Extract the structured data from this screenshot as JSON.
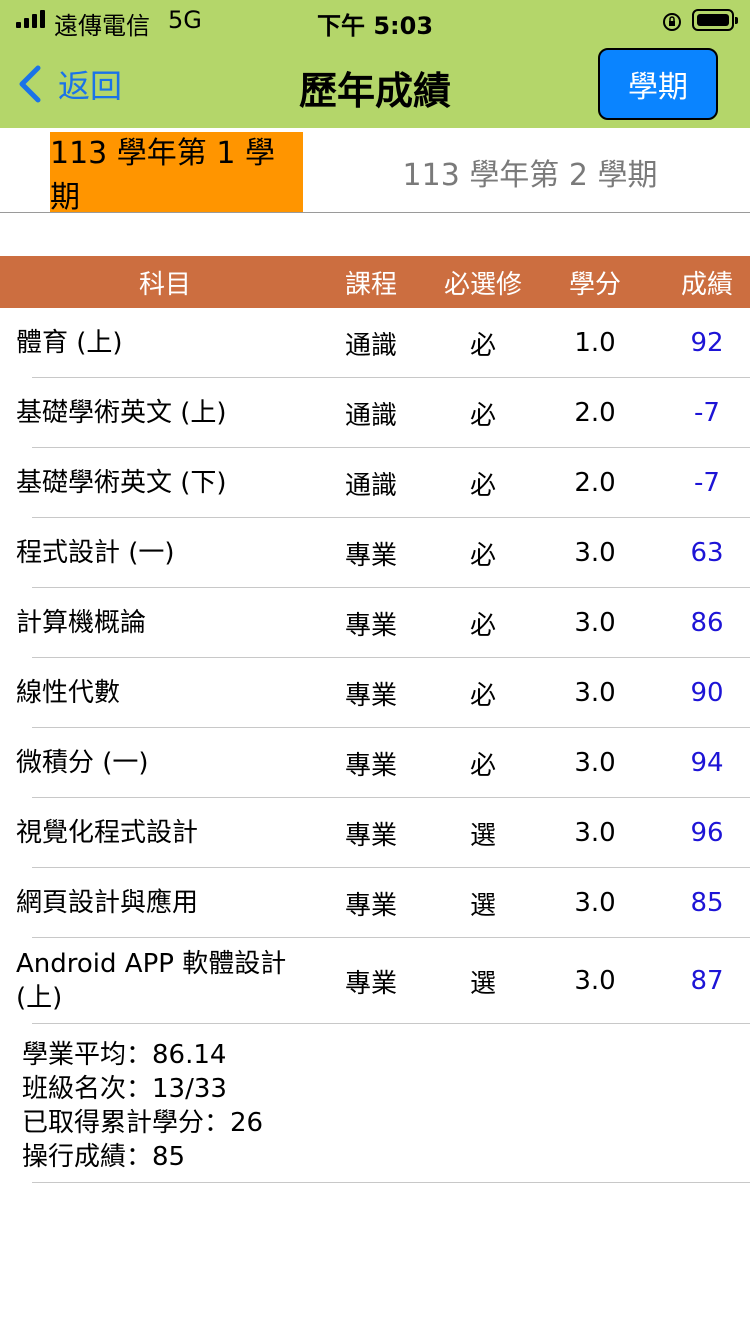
{
  "status_bar": {
    "carrier": "遠傳電信",
    "network": "5G",
    "time": "下午 5:03"
  },
  "nav": {
    "back_label": "返回",
    "title": "歷年成績",
    "semester_button": "學期"
  },
  "tabs": [
    {
      "label": "113 學年第 1 學期",
      "active": true
    },
    {
      "label": "113 學年第 2 學期",
      "active": false
    }
  ],
  "table": {
    "headers": [
      "科目",
      "課程",
      "必選修",
      "學分",
      "成績"
    ],
    "rows": [
      {
        "subject": "體育 (上)",
        "type": "通識",
        "req": "必",
        "credits": "1.0",
        "score": "92"
      },
      {
        "subject": "基礎學術英文 (上)",
        "type": "通識",
        "req": "必",
        "credits": "2.0",
        "score": "-7"
      },
      {
        "subject": "基礎學術英文 (下)",
        "type": "通識",
        "req": "必",
        "credits": "2.0",
        "score": "-7"
      },
      {
        "subject": "程式設計 (一)",
        "type": "專業",
        "req": "必",
        "credits": "3.0",
        "score": "63"
      },
      {
        "subject": "計算機概論",
        "type": "專業",
        "req": "必",
        "credits": "3.0",
        "score": "86"
      },
      {
        "subject": "線性代數",
        "type": "專業",
        "req": "必",
        "credits": "3.0",
        "score": "90"
      },
      {
        "subject": "微積分 (一)",
        "type": "專業",
        "req": "必",
        "credits": "3.0",
        "score": "94"
      },
      {
        "subject": "視覺化程式設計",
        "type": "專業",
        "req": "選",
        "credits": "3.0",
        "score": "96"
      },
      {
        "subject": "網頁設計與應用",
        "type": "專業",
        "req": "選",
        "credits": "3.0",
        "score": "85"
      },
      {
        "subject": "Android APP 軟體設計 (上)",
        "type": "專業",
        "req": "選",
        "credits": "3.0",
        "score": "87"
      }
    ]
  },
  "summary": {
    "average": "學業平均：86.14",
    "rank": "班級名次：13/33",
    "credits_earned": "已取得累計學分：26",
    "conduct": "操行成績：85"
  },
  "colors": {
    "header_bg": "#b4d66a",
    "active_tab": "#ff9500",
    "table_header": "#cc6e40",
    "score_text": "#1d14d6",
    "button": "#0a84ff"
  }
}
